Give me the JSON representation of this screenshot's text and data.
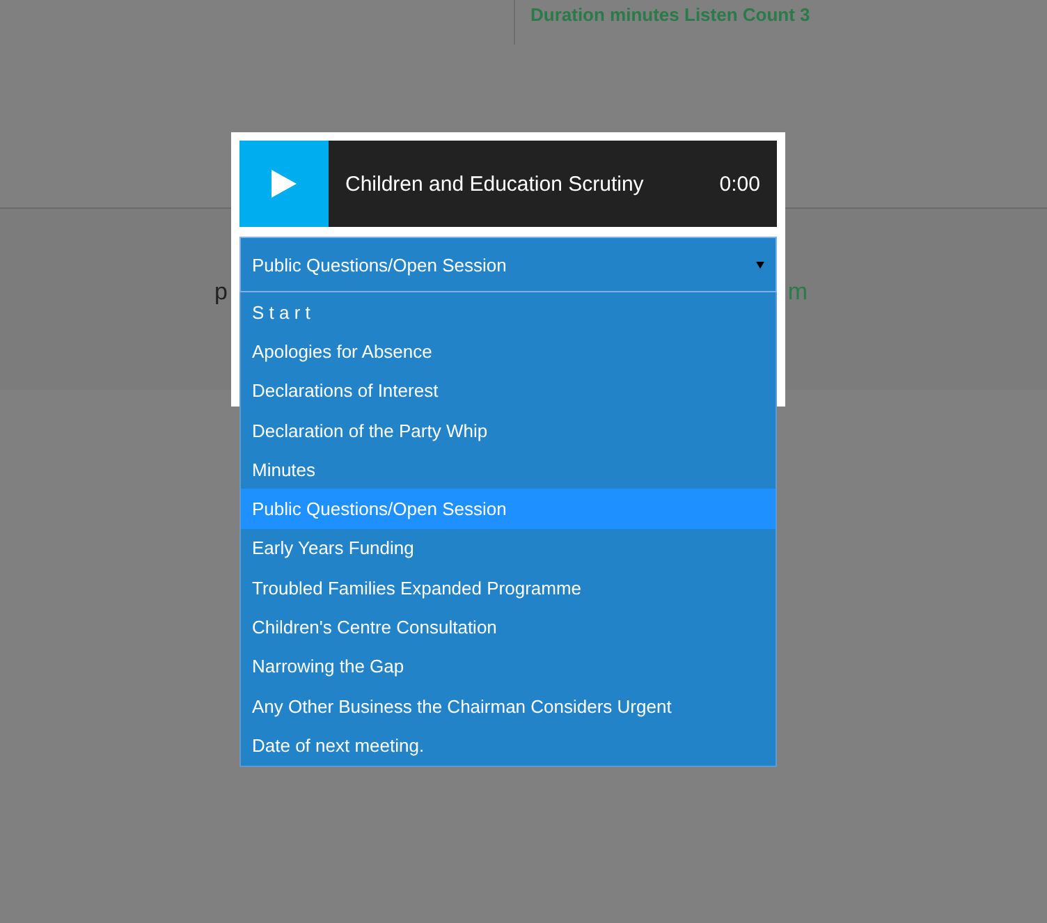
{
  "background": {
    "stats": "Duration minutes Listen Count 3",
    "fragment_left": "p",
    "fragment_right": "m"
  },
  "player": {
    "title": "Children and Education Scrutiny",
    "time": "0:00"
  },
  "agenda_select": {
    "value": "Public Questions/Open Session",
    "expanded": true,
    "options": [
      {
        "label": "S t a r t",
        "selected": false
      },
      {
        "label": "Apologies for Absence",
        "selected": false
      },
      {
        "label": "Declarations of Interest",
        "selected": false
      },
      {
        "label": "Declaration of the Party Whip",
        "selected": false
      },
      {
        "label": "Minutes",
        "selected": false
      },
      {
        "label": "Public Questions/Open Session",
        "selected": true
      },
      {
        "label": "Early Years Funding",
        "selected": false
      },
      {
        "label": "Troubled Families Expanded Programme",
        "selected": false
      },
      {
        "label": "Children's Centre Consultation",
        "selected": false
      },
      {
        "label": "Narrowing the Gap",
        "selected": false
      },
      {
        "label": "Any Other Business the Chairman Considers Urgent",
        "selected": false
      },
      {
        "label": "Date of next meeting.",
        "selected": false
      }
    ]
  }
}
